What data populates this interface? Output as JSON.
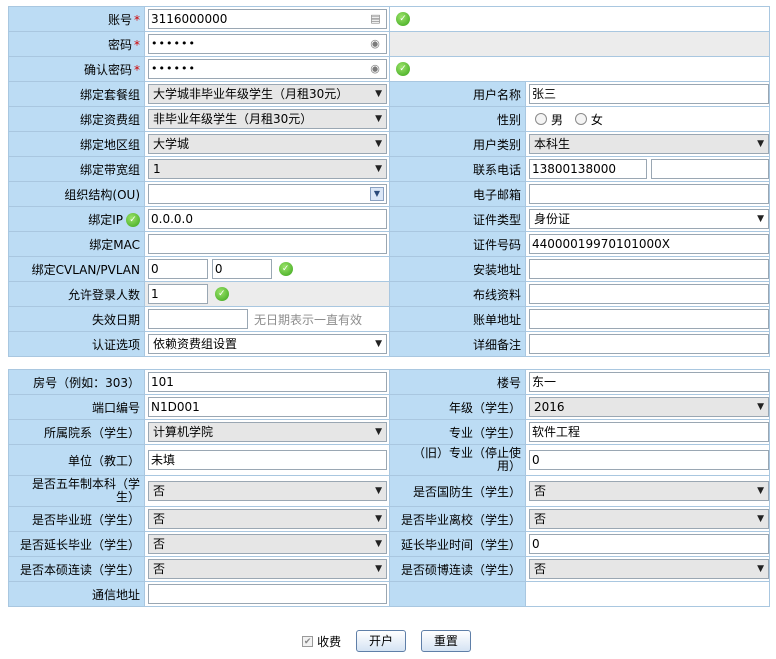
{
  "required_mark": "*",
  "ok_icon_glyph": "✓",
  "arrow_glyph": "▼",
  "account": {
    "account_label": "账号",
    "account_value": "3116000000",
    "password_label": "密码",
    "password_value": "••••••",
    "confirm_label": "确认密码",
    "confirm_value": "••••••"
  },
  "left": {
    "package_label": "绑定套餐组",
    "package_value": "大学城非毕业年级学生（月租30元）",
    "fee_label": "绑定资费组",
    "fee_value": "非毕业年级学生（月租30元）",
    "region_label": "绑定地区组",
    "region_value": "大学城",
    "bandwidth_label": "绑定带宽组",
    "bandwidth_value": "1",
    "ou_label": "组织结构(OU)",
    "ou_value": "",
    "ip_label": "绑定IP",
    "ip_value": "0.0.0.0",
    "mac_label": "绑定MAC",
    "mac_value": "",
    "vlan_label": "绑定CVLAN/PVLAN",
    "cvlan_value": "0",
    "pvlan_value": "0",
    "max_login_label": "允许登录人数",
    "max_login_value": "1",
    "expire_label": "失效日期",
    "expire_value": "",
    "expire_hint": "无日期表示一直有效",
    "auth_label": "认证选项",
    "auth_value": "依赖资费组设置"
  },
  "right": {
    "username_label": "用户名称",
    "username_value": "张三",
    "gender_label": "性别",
    "gender_male": "男",
    "gender_female": "女",
    "usertype_label": "用户类别",
    "usertype_value": "本科生",
    "phone_label": "联系电话",
    "phone_value": "13800138000",
    "phone2_value": "",
    "email_label": "电子邮箱",
    "email_value": "",
    "idtype_label": "证件类型",
    "idtype_value": "身份证",
    "idno_label": "证件号码",
    "idno_value": "44000019970101000X",
    "install_label": "安装地址",
    "install_value": "",
    "wiring_label": "布线资料",
    "wiring_value": "",
    "bill_label": "账单地址",
    "bill_value": "",
    "remark_label": "详细备注",
    "remark_value": ""
  },
  "extra": {
    "room_label": "房号（例如：303）",
    "room_value": "101",
    "building_label": "楼号",
    "building_value": "东一",
    "port_label": "端口编号",
    "port_value": "N1D001",
    "grade_label": "年级（学生）",
    "grade_value": "2016",
    "dept_label": "所属院系（学生）",
    "dept_value": "计算机学院",
    "major_label": "专业（学生）",
    "major_value": "软件工程",
    "unit_label": "单位（教工）",
    "unit_value": "未填",
    "oldmajor_label_1": "（旧）专业（停止使",
    "oldmajor_label_2": "用）",
    "oldmajor_value": "0",
    "fiveyear_label_1": "是否五年制本科（学",
    "fiveyear_label_2": "生）",
    "fiveyear_value": "否",
    "defense_label": "是否国防生（学生）",
    "defense_value": "否",
    "gradclass_label": "是否毕业班（学生）",
    "gradclass_value": "否",
    "gradleave_label": "是否毕业离校（学生）",
    "gradleave_value": "否",
    "extended_label": "是否延长毕业（学生）",
    "extended_value": "否",
    "extendtime_label": "延长毕业时间（学生）",
    "extendtime_value": "0",
    "bachmaster_label": "是否本硕连读（学生）",
    "bachmaster_value": "否",
    "masterphd_label": "是否硕博连读（学生）",
    "masterphd_value": "否",
    "mail_label": "通信地址",
    "mail_value": ""
  },
  "footer": {
    "charge_label": "收费",
    "charge_checked": true,
    "open_button": "开户",
    "reset_button": "重置"
  }
}
